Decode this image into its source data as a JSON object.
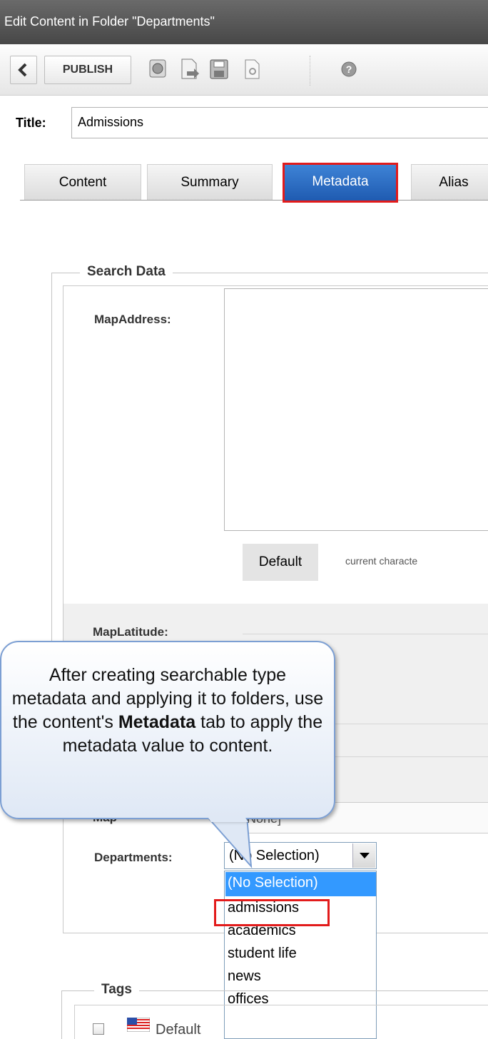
{
  "window": {
    "title": "Edit Content in Folder \"Departments\""
  },
  "toolbar": {
    "publish_label": "PUBLISH",
    "icons": [
      "back-arrow-icon",
      "checkin-icon",
      "preview-icon",
      "save-icon",
      "properties-icon",
      "help-icon"
    ]
  },
  "title_field": {
    "label": "Title:",
    "value": "Admissions"
  },
  "tabs": [
    {
      "label": "Content"
    },
    {
      "label": "Summary"
    },
    {
      "label": "Metadata",
      "active": true
    },
    {
      "label": "Alias"
    }
  ],
  "search_data": {
    "legend": "Search Data",
    "map_address_label": "MapAddress:",
    "default_button": "Default",
    "char_note": "current characte",
    "map_latitude_label": "MapLatitude:",
    "map_trunc_label": "Map",
    "none_value": "[None]",
    "departments_label": "Departments:",
    "departments_selected": "(No Selection)",
    "departments_options": [
      "(No Selection)",
      "admissions",
      "academics",
      "student life",
      "news",
      "offices"
    ]
  },
  "tags": {
    "legend": "Tags",
    "default_label": "Default"
  },
  "callout": {
    "text_before": "After creating searchable type metadata and applying it to folders, use the content's",
    "text_bold": "Metadata",
    "text_after": "tab to apply the metadata value to content."
  },
  "colors": {
    "accent_blue": "#1f5bb1",
    "highlight_red": "#e21b1b",
    "selection_blue": "#3399ff"
  }
}
